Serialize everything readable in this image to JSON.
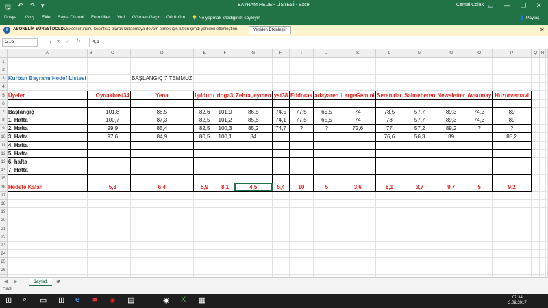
{
  "window": {
    "title": "BAYRAM HEDEF LİSTESİ  -  Excel",
    "user": "Cemal Colak",
    "tell_me": "Ne yapmak istediğinizi söyleyin",
    "share": "Paylaş"
  },
  "ribbon": {
    "tabs": [
      "Dosya",
      "Giriş",
      "Ekle",
      "Sayfa Düzeni",
      "Formüller",
      "Veri",
      "Gözden Geçir",
      "Görünüm"
    ]
  },
  "message_bar": {
    "title": "ABONELİK SÜRESİ DOLDU",
    "text": "Excel ürününü kesintisiz olarak kullanmaya devam etmek için lütfen şimdi yeniden etkinleştirin.",
    "button": "Yeniden Etkinleştir"
  },
  "formula_bar": {
    "name_box": "G16",
    "formula": "4,5"
  },
  "sheet": {
    "columns": [
      "A",
      "B",
      "C",
      "D",
      "E",
      "F",
      "G",
      "H",
      "I",
      "J",
      "K",
      "L",
      "M",
      "N",
      "O",
      "P",
      "Q",
      "R"
    ],
    "title": "Kurban Bayramı Hedef Listesi",
    "start": "BAŞLANGIÇ 7 TEMMUZ",
    "header": [
      "Üyeler",
      "Oynakbasi34",
      "Yena",
      "Işılduru",
      "doga3",
      "Zehra_eymen",
      "yst38",
      "Eddoras",
      "adayaren",
      "LargeGemini",
      "Serenalar",
      "Saimeberen",
      "Newsletter",
      "Avsumay",
      "Huzurvemavi"
    ],
    "rows": [
      [
        "Başlangıç",
        "101,8",
        "88,5",
        "82,6",
        "101,9",
        "86,5",
        "74,5",
        "77,5",
        "65,5",
        "74",
        "78,5",
        "57,7",
        "89,3",
        "74,3",
        "89"
      ],
      [
        "1. Hafta",
        "100,7",
        "87,3",
        "82,5",
        "101,2",
        "85,5",
        "74,1",
        "77,5",
        "65,5",
        "74",
        "78",
        "57,7",
        "89,3",
        "74,3",
        "89"
      ],
      [
        "2. Hafta",
        "99,9",
        "85,4",
        "82,5",
        "100,3",
        "85,2",
        "74,7",
        "?",
        "?",
        "72,6",
        "77",
        "57,2",
        "89,2",
        "?",
        "?"
      ],
      [
        "3. Hafta",
        "97,6",
        "84,9",
        "80,5",
        "100,1",
        "84",
        "",
        "",
        "",
        "",
        "76,6",
        "56,3",
        "89",
        "",
        "88,2"
      ],
      [
        "4. Hafta",
        "",
        "",
        "",
        "",
        "",
        "",
        "",
        "",
        "",
        "",
        "",
        "",
        "",
        ""
      ],
      [
        "5. Hafta",
        "",
        "",
        "",
        "",
        "",
        "",
        "",
        "",
        "",
        "",
        "",
        "",
        "",
        ""
      ],
      [
        "6. hafta",
        "",
        "",
        "",
        "",
        "",
        "",
        "",
        "",
        "",
        "",
        "",
        "",
        "",
        ""
      ],
      [
        "7. Hafta",
        "",
        "",
        "",
        "",
        "",
        "",
        "",
        "",
        "",
        "",
        "",
        "",
        "",
        ""
      ]
    ],
    "target": [
      "Hedefe Kalan",
      "5,8",
      "6,4",
      "5,9",
      "8,1",
      "4,5",
      "5,4",
      "10",
      "5",
      "3,6",
      "8,1",
      "3,7",
      "9,7",
      "5",
      "9,2"
    ],
    "accent_red": "#e0241e",
    "accent_blue": "#2f75b5"
  },
  "sheet_tab": "Sayfa1",
  "status": "Hazır",
  "clock": {
    "time": "07:34",
    "date": "2.08.2017"
  }
}
